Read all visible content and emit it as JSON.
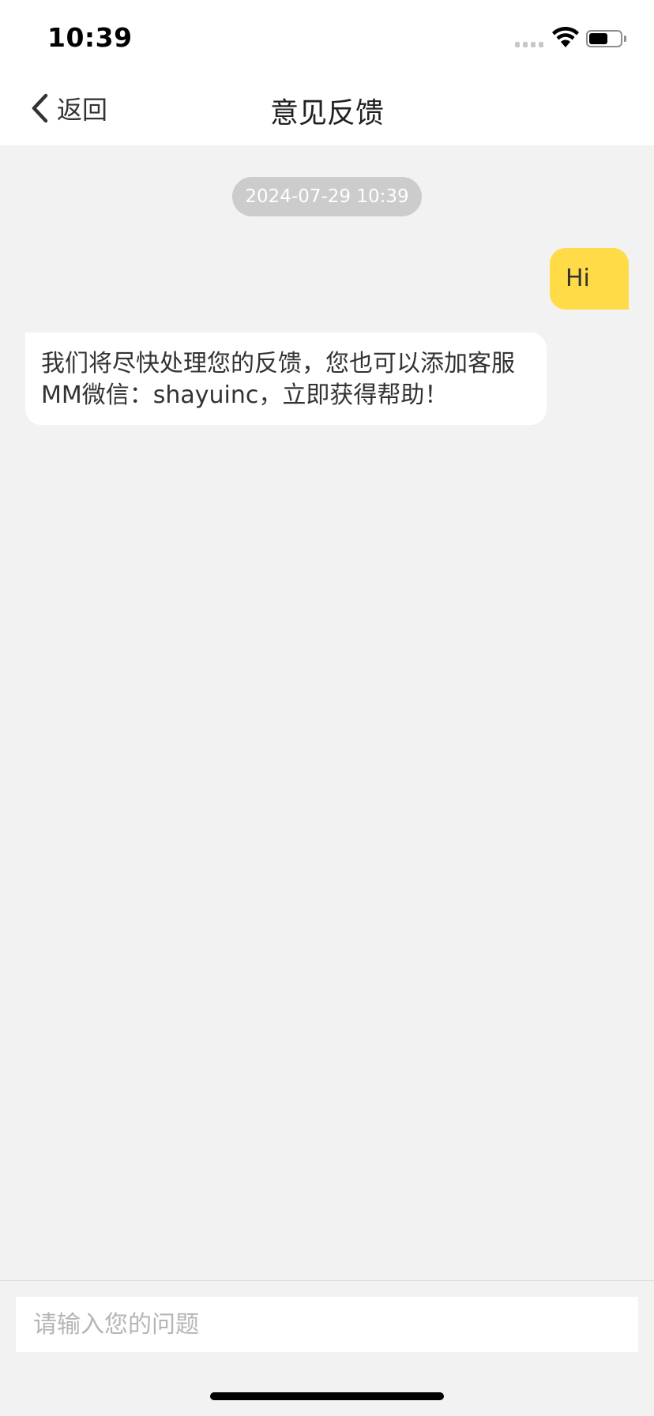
{
  "status_bar": {
    "time": "10:39",
    "battery_level": 0.6
  },
  "nav": {
    "back_label": "返回",
    "title": "意见反馈"
  },
  "chat": {
    "timestamp": "2024-07-29 10:39",
    "messages": [
      {
        "sender": "me",
        "text": "Hi"
      },
      {
        "sender": "support",
        "text": "我们将尽快处理您的反馈，您也可以添加客服MM微信：shayuinc，立即获得帮助！"
      }
    ]
  },
  "input": {
    "placeholder": "请输入您的问题",
    "value": ""
  },
  "colors": {
    "my_bubble": "#ffdb47",
    "their_bubble": "#ffffff",
    "background": "#f2f2f2",
    "timestamp_pill": "#cccccc"
  }
}
